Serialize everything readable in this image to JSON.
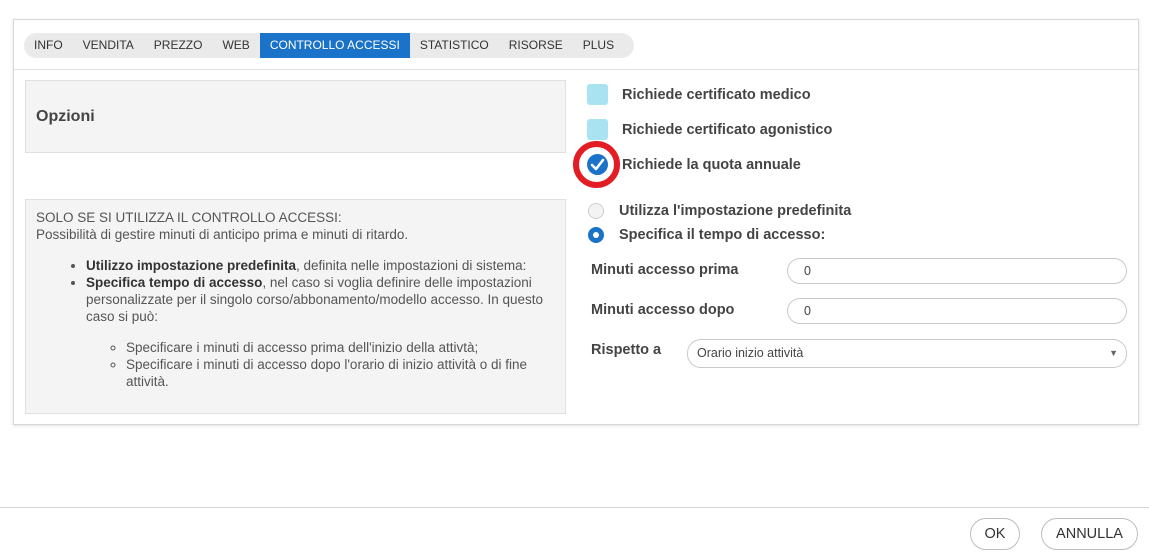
{
  "tabs": [
    "INFO",
    "VENDITA",
    "PREZZO",
    "WEB",
    "CONTROLLO ACCESSI",
    "STATISTICO",
    "RISORSE",
    "PLUS"
  ],
  "active_tab": "CONTROLLO ACCESSI",
  "options_box": {
    "title": "Opzioni"
  },
  "help": {
    "line1": "SOLO SE SI UTILIZZA IL CONTROLLO ACCESSI:",
    "line2": "Possibilità di gestire minuti di anticipo prima e minuti di ritardo.",
    "bullet1_bold": "Utilizzo impostazione predefinita",
    "bullet1_rest": ", definita nelle impostazioni di sistema:",
    "bullet2_bold": "Specifica tempo di accesso",
    "bullet2_rest": ", nel caso si voglia definire delle impostazioni personalizzate per il singolo corso/abbonamento/modello accesso. In questo caso si può:",
    "sub1": "Specificare i minuti di accesso prima dell'inizio della attivtà;",
    "sub2": "Specificare i minuti di accesso dopo l'orario di inizio attività o di fine attività."
  },
  "checkboxes": [
    {
      "label": "Richiede certificato medico",
      "checked": false
    },
    {
      "label": "Richiede certificato agonistico",
      "checked": false
    },
    {
      "label": "Richiede la quota annuale",
      "checked": true
    }
  ],
  "radios": [
    {
      "label": "Utilizza l'impostazione predefinita",
      "selected": false
    },
    {
      "label": "Specifica il tempo di accesso:",
      "selected": true
    }
  ],
  "fields": {
    "before_label": "Minuti accesso prima",
    "before_value": "0",
    "after_label": "Minuti accesso dopo",
    "after_value": "0",
    "respect_label": "Rispetto a",
    "respect_value": "Orario inizio attività"
  },
  "buttons": {
    "ok": "OK",
    "cancel": "ANNULLA"
  },
  "colors": {
    "accent": "#1a73c8",
    "checkbox_empty": "#a9e3f2",
    "highlight_ring": "#e21d24"
  }
}
